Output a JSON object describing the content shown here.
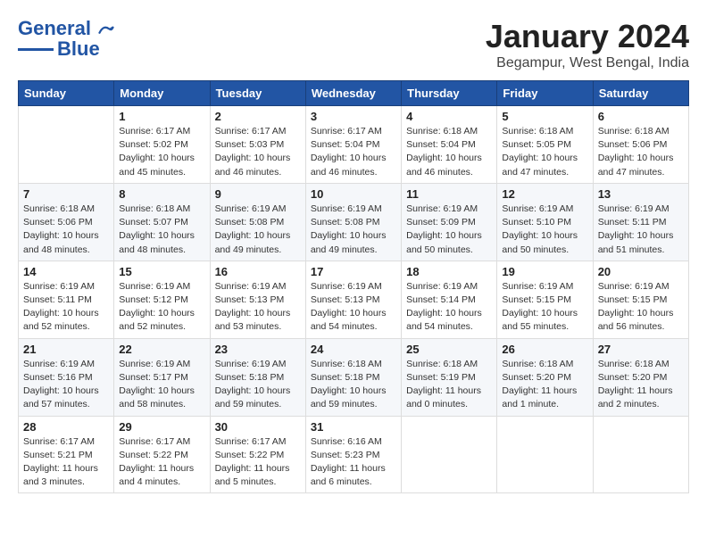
{
  "header": {
    "logo_line1": "General",
    "logo_line2": "Blue",
    "month_title": "January 2024",
    "subtitle": "Begampur, West Bengal, India"
  },
  "calendar": {
    "headers": [
      "Sunday",
      "Monday",
      "Tuesday",
      "Wednesday",
      "Thursday",
      "Friday",
      "Saturday"
    ],
    "weeks": [
      [
        {
          "day": "",
          "sunrise": "",
          "sunset": "",
          "daylight": ""
        },
        {
          "day": "1",
          "sunrise": "Sunrise: 6:17 AM",
          "sunset": "Sunset: 5:02 PM",
          "daylight": "Daylight: 10 hours and 45 minutes."
        },
        {
          "day": "2",
          "sunrise": "Sunrise: 6:17 AM",
          "sunset": "Sunset: 5:03 PM",
          "daylight": "Daylight: 10 hours and 46 minutes."
        },
        {
          "day": "3",
          "sunrise": "Sunrise: 6:17 AM",
          "sunset": "Sunset: 5:04 PM",
          "daylight": "Daylight: 10 hours and 46 minutes."
        },
        {
          "day": "4",
          "sunrise": "Sunrise: 6:18 AM",
          "sunset": "Sunset: 5:04 PM",
          "daylight": "Daylight: 10 hours and 46 minutes."
        },
        {
          "day": "5",
          "sunrise": "Sunrise: 6:18 AM",
          "sunset": "Sunset: 5:05 PM",
          "daylight": "Daylight: 10 hours and 47 minutes."
        },
        {
          "day": "6",
          "sunrise": "Sunrise: 6:18 AM",
          "sunset": "Sunset: 5:06 PM",
          "daylight": "Daylight: 10 hours and 47 minutes."
        }
      ],
      [
        {
          "day": "7",
          "sunrise": "Sunrise: 6:18 AM",
          "sunset": "Sunset: 5:06 PM",
          "daylight": "Daylight: 10 hours and 48 minutes."
        },
        {
          "day": "8",
          "sunrise": "Sunrise: 6:18 AM",
          "sunset": "Sunset: 5:07 PM",
          "daylight": "Daylight: 10 hours and 48 minutes."
        },
        {
          "day": "9",
          "sunrise": "Sunrise: 6:19 AM",
          "sunset": "Sunset: 5:08 PM",
          "daylight": "Daylight: 10 hours and 49 minutes."
        },
        {
          "day": "10",
          "sunrise": "Sunrise: 6:19 AM",
          "sunset": "Sunset: 5:08 PM",
          "daylight": "Daylight: 10 hours and 49 minutes."
        },
        {
          "day": "11",
          "sunrise": "Sunrise: 6:19 AM",
          "sunset": "Sunset: 5:09 PM",
          "daylight": "Daylight: 10 hours and 50 minutes."
        },
        {
          "day": "12",
          "sunrise": "Sunrise: 6:19 AM",
          "sunset": "Sunset: 5:10 PM",
          "daylight": "Daylight: 10 hours and 50 minutes."
        },
        {
          "day": "13",
          "sunrise": "Sunrise: 6:19 AM",
          "sunset": "Sunset: 5:11 PM",
          "daylight": "Daylight: 10 hours and 51 minutes."
        }
      ],
      [
        {
          "day": "14",
          "sunrise": "Sunrise: 6:19 AM",
          "sunset": "Sunset: 5:11 PM",
          "daylight": "Daylight: 10 hours and 52 minutes."
        },
        {
          "day": "15",
          "sunrise": "Sunrise: 6:19 AM",
          "sunset": "Sunset: 5:12 PM",
          "daylight": "Daylight: 10 hours and 52 minutes."
        },
        {
          "day": "16",
          "sunrise": "Sunrise: 6:19 AM",
          "sunset": "Sunset: 5:13 PM",
          "daylight": "Daylight: 10 hours and 53 minutes."
        },
        {
          "day": "17",
          "sunrise": "Sunrise: 6:19 AM",
          "sunset": "Sunset: 5:13 PM",
          "daylight": "Daylight: 10 hours and 54 minutes."
        },
        {
          "day": "18",
          "sunrise": "Sunrise: 6:19 AM",
          "sunset": "Sunset: 5:14 PM",
          "daylight": "Daylight: 10 hours and 54 minutes."
        },
        {
          "day": "19",
          "sunrise": "Sunrise: 6:19 AM",
          "sunset": "Sunset: 5:15 PM",
          "daylight": "Daylight: 10 hours and 55 minutes."
        },
        {
          "day": "20",
          "sunrise": "Sunrise: 6:19 AM",
          "sunset": "Sunset: 5:15 PM",
          "daylight": "Daylight: 10 hours and 56 minutes."
        }
      ],
      [
        {
          "day": "21",
          "sunrise": "Sunrise: 6:19 AM",
          "sunset": "Sunset: 5:16 PM",
          "daylight": "Daylight: 10 hours and 57 minutes."
        },
        {
          "day": "22",
          "sunrise": "Sunrise: 6:19 AM",
          "sunset": "Sunset: 5:17 PM",
          "daylight": "Daylight: 10 hours and 58 minutes."
        },
        {
          "day": "23",
          "sunrise": "Sunrise: 6:19 AM",
          "sunset": "Sunset: 5:18 PM",
          "daylight": "Daylight: 10 hours and 59 minutes."
        },
        {
          "day": "24",
          "sunrise": "Sunrise: 6:18 AM",
          "sunset": "Sunset: 5:18 PM",
          "daylight": "Daylight: 10 hours and 59 minutes."
        },
        {
          "day": "25",
          "sunrise": "Sunrise: 6:18 AM",
          "sunset": "Sunset: 5:19 PM",
          "daylight": "Daylight: 11 hours and 0 minutes."
        },
        {
          "day": "26",
          "sunrise": "Sunrise: 6:18 AM",
          "sunset": "Sunset: 5:20 PM",
          "daylight": "Daylight: 11 hours and 1 minute."
        },
        {
          "day": "27",
          "sunrise": "Sunrise: 6:18 AM",
          "sunset": "Sunset: 5:20 PM",
          "daylight": "Daylight: 11 hours and 2 minutes."
        }
      ],
      [
        {
          "day": "28",
          "sunrise": "Sunrise: 6:17 AM",
          "sunset": "Sunset: 5:21 PM",
          "daylight": "Daylight: 11 hours and 3 minutes."
        },
        {
          "day": "29",
          "sunrise": "Sunrise: 6:17 AM",
          "sunset": "Sunset: 5:22 PM",
          "daylight": "Daylight: 11 hours and 4 minutes."
        },
        {
          "day": "30",
          "sunrise": "Sunrise: 6:17 AM",
          "sunset": "Sunset: 5:22 PM",
          "daylight": "Daylight: 11 hours and 5 minutes."
        },
        {
          "day": "31",
          "sunrise": "Sunrise: 6:16 AM",
          "sunset": "Sunset: 5:23 PM",
          "daylight": "Daylight: 11 hours and 6 minutes."
        },
        {
          "day": "",
          "sunrise": "",
          "sunset": "",
          "daylight": ""
        },
        {
          "day": "",
          "sunrise": "",
          "sunset": "",
          "daylight": ""
        },
        {
          "day": "",
          "sunrise": "",
          "sunset": "",
          "daylight": ""
        }
      ]
    ]
  }
}
